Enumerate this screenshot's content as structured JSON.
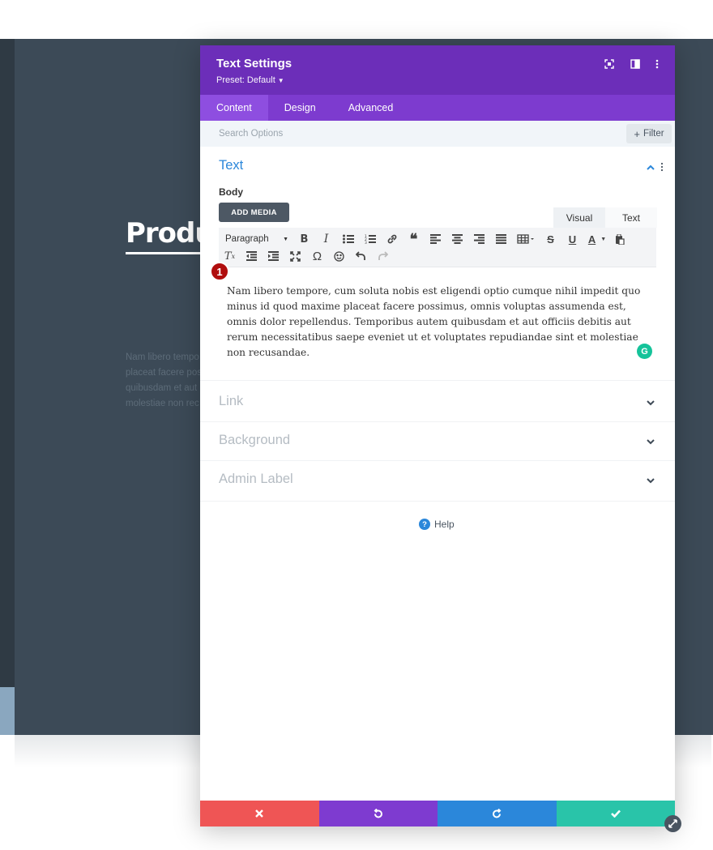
{
  "background": {
    "heading": "Produc",
    "paragraph_lines": [
      "Nam libero tempo",
      "placeat facere pos",
      "quibusdam et aut",
      "molestiae non rec"
    ]
  },
  "modal": {
    "title": "Text Settings",
    "preset_label": "Preset: Default",
    "header_icons": [
      "expand-icon",
      "sidebar-layout-icon",
      "more-options-icon"
    ],
    "tabs": [
      {
        "label": "Content",
        "active": true
      },
      {
        "label": "Design",
        "active": false
      },
      {
        "label": "Advanced",
        "active": false
      }
    ],
    "search": {
      "placeholder": "Search Options",
      "filter_label": "Filter"
    },
    "text_section": {
      "title": "Text",
      "body_label": "Body",
      "add_media_label": "ADD MEDIA",
      "editor_tabs": {
        "visual": "Visual",
        "text": "Text"
      },
      "paragraph_select": "Paragraph",
      "marker_number": "1",
      "content": "Nam libero tempore, cum soluta nobis est eligendi optio cumque nihil impedit quo minus id quod maxime placeat facere possimus, omnis voluptas assumenda est, omnis dolor repellendus. Temporibus autem quibusdam et aut officiis debitis aut rerum necessitatibus saepe eveniet ut et voluptates repudiandae sint et molestiae non recusandae.",
      "grammarly_letter": "G"
    },
    "collapsed_sections": [
      {
        "title": "Link"
      },
      {
        "title": "Background"
      },
      {
        "title": "Admin Label"
      }
    ],
    "help_label": "Help",
    "footer_colors": {
      "cancel": "#ef5555",
      "undo": "#7e3bd0",
      "redo": "#2b87da",
      "save": "#29c4a9"
    }
  },
  "colors": {
    "header": "#6c2eb9",
    "tabs": "#7d3bcf",
    "active_tab": "#8e4ee0",
    "accent": "#2b87da"
  }
}
